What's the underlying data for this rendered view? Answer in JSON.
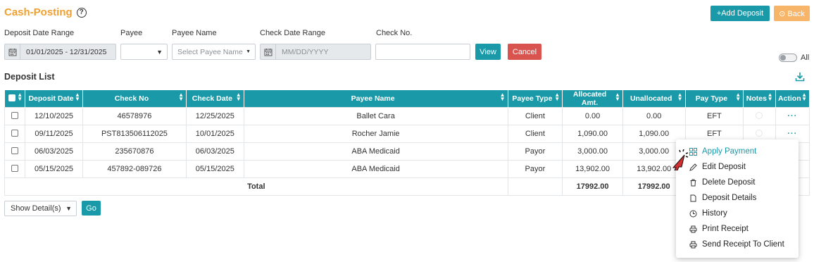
{
  "page": {
    "title": "Cash-Posting",
    "help_icon": "question-circle-icon"
  },
  "header_buttons": {
    "add_deposit": "+Add Deposit",
    "back": "⊙ Back"
  },
  "filters": {
    "deposit_date_range": {
      "label": "Deposit Date Range",
      "value": "01/01/2025 - 12/31/2025"
    },
    "payee": {
      "label": "Payee",
      "value": ""
    },
    "payee_name": {
      "label": "Payee Name",
      "placeholder": "Select Payee Name"
    },
    "check_date_range": {
      "label": "Check Date Range",
      "placeholder": "MM/DD/YYYY"
    },
    "check_no": {
      "label": "Check No.",
      "value": ""
    },
    "view_button": "View",
    "cancel_button": "Cancel",
    "all_toggle_label": "All"
  },
  "deposit_list": {
    "title": "Deposit List",
    "columns": [
      "Deposit Date",
      "Check No",
      "Check Date",
      "Payee Name",
      "Payee Type",
      "Allocated Amt.",
      "Unallocated",
      "Pay Type",
      "Notes",
      "Action"
    ],
    "rows": [
      {
        "deposit_date": "12/10/2025",
        "check_no": "46578976",
        "check_date": "12/25/2025",
        "payee_name": "Ballet Cara",
        "payee_type": "Client",
        "allocated": "0.00",
        "unallocated": "0.00",
        "pay_type": "EFT",
        "action": "···"
      },
      {
        "deposit_date": "09/11/2025",
        "check_no": "PST813506112025",
        "check_date": "10/01/2025",
        "payee_name": "Rocher Jamie",
        "payee_type": "Client",
        "allocated": "1,090.00",
        "unallocated": "1,090.00",
        "pay_type": "EFT",
        "action": "···"
      },
      {
        "deposit_date": "06/03/2025",
        "check_no": "235670876",
        "check_date": "06/03/2025",
        "payee_name": "ABA Medicaid",
        "payee_type": "Payor",
        "allocated": "3,000.00",
        "unallocated": "3,000.00",
        "pay_type": "",
        "action": ""
      },
      {
        "deposit_date": "05/15/2025",
        "check_no": "457892-089726",
        "check_date": "05/15/2025",
        "payee_name": "ABA Medicaid",
        "payee_type": "Payor",
        "allocated": "13,902.00",
        "unallocated": "13,902.00",
        "pay_type": "",
        "action": ""
      }
    ],
    "total_label": "Total",
    "total_allocated": "17992.00",
    "total_unallocated": "17992.00"
  },
  "footer": {
    "show_select": "Show Detail(s)",
    "go_button": "Go"
  },
  "action_menu": {
    "items": [
      {
        "label": "Apply Payment",
        "icon": "grid-icon"
      },
      {
        "label": "Edit Deposit",
        "icon": "pencil-icon"
      },
      {
        "label": "Delete Deposit",
        "icon": "trash-icon"
      },
      {
        "label": "Deposit Details",
        "icon": "document-icon"
      },
      {
        "label": "History",
        "icon": "clock-icon"
      },
      {
        "label": "Print Receipt",
        "icon": "printer-icon"
      },
      {
        "label": "Send Receipt To Client",
        "icon": "printer-icon"
      }
    ]
  },
  "colors": {
    "accent": "#1a9aa8",
    "title": "#f0a030",
    "cancel": "#d9534f",
    "back": "#f7b56a"
  }
}
